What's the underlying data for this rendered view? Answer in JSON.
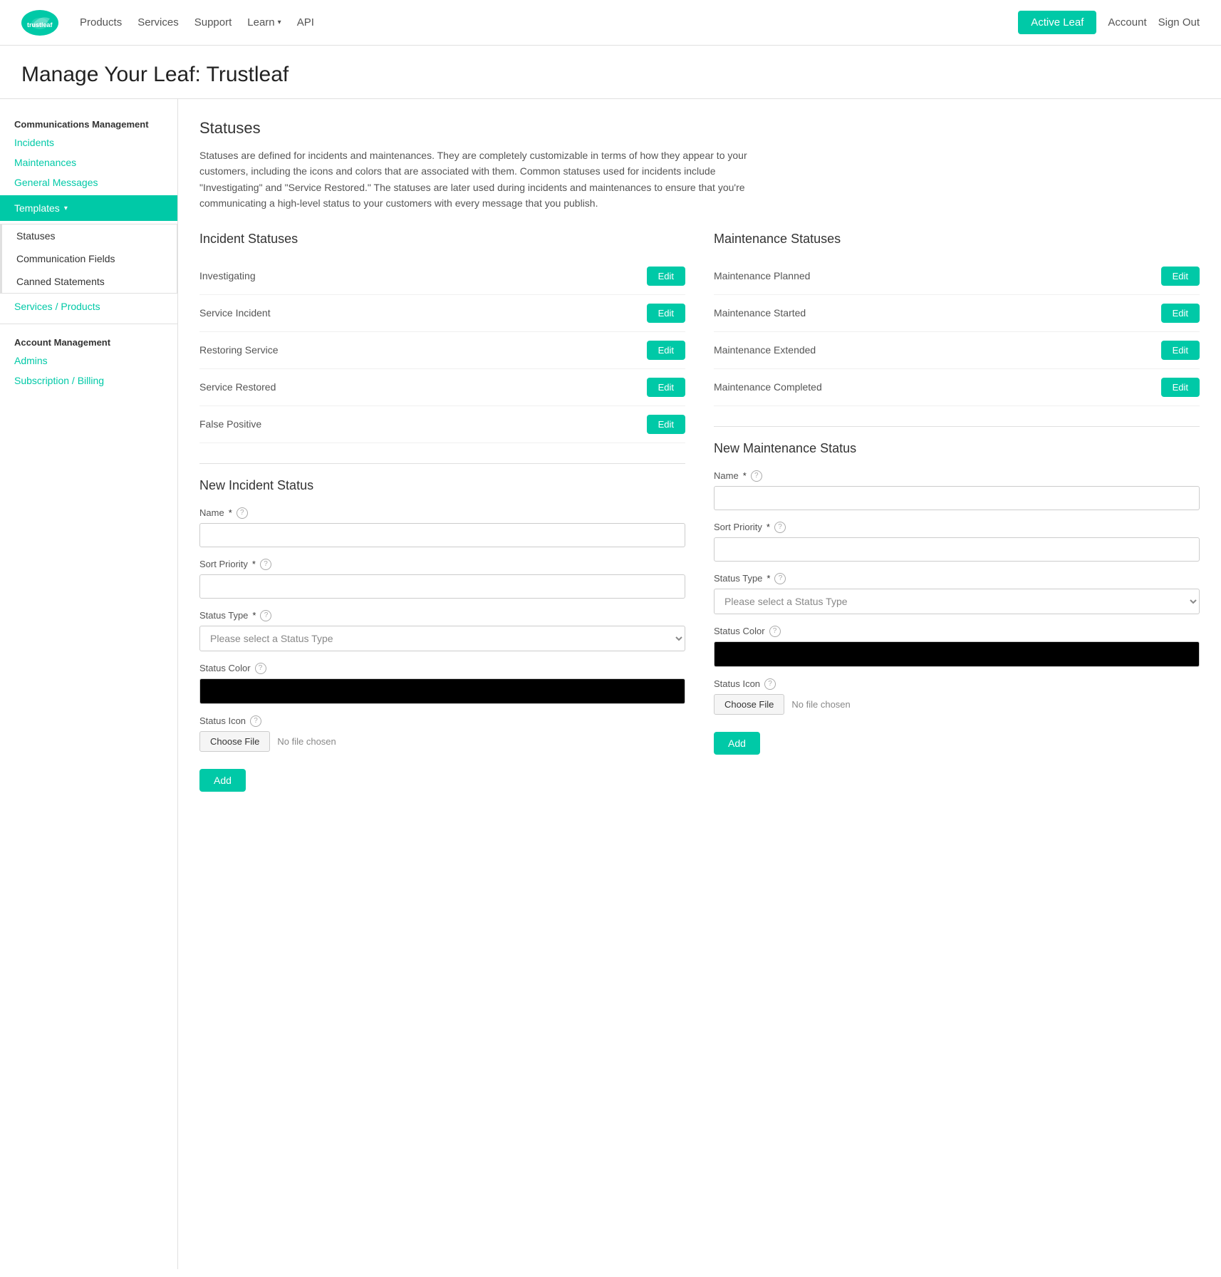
{
  "nav": {
    "logo_alt": "trustleaf",
    "links": [
      "Products",
      "Services",
      "Support",
      "Learn",
      "API"
    ],
    "active_leaf_label": "Active Leaf",
    "account_label": "Account",
    "sign_out_label": "Sign Out"
  },
  "page": {
    "title": "Manage Your Leaf: Trustleaf"
  },
  "sidebar": {
    "comm_management_label": "Communications Management",
    "incidents_label": "Incidents",
    "maintenances_label": "Maintenances",
    "general_messages_label": "General Messages",
    "templates_label": "Templates",
    "statuses_label": "Statuses",
    "comm_fields_label": "Communication Fields",
    "canned_statements_label": "Canned Statements",
    "services_products_label": "Services / Products",
    "account_management_label": "Account Management",
    "admins_label": "Admins",
    "subscription_billing_label": "Subscription / Billing"
  },
  "content": {
    "section_title": "Statuses",
    "section_desc": "Statuses are defined for incidents and maintenances. They are completely customizable in terms of how they appear to your customers, including the icons and colors that are associated with them. Common statuses used for incidents include \"Investigating\" and \"Service Restored.\" The statuses are later used during incidents and maintenances to ensure that you're communicating a high-level status to your customers with every message that you publish.",
    "incident_statuses_title": "Incident Statuses",
    "incident_statuses": [
      {
        "name": "Investigating"
      },
      {
        "name": "Service Incident"
      },
      {
        "name": "Restoring Service"
      },
      {
        "name": "Service Restored"
      },
      {
        "name": "False Positive"
      }
    ],
    "edit_label": "Edit",
    "maintenance_statuses_title": "Maintenance Statuses",
    "maintenance_statuses": [
      {
        "name": "Maintenance Planned"
      },
      {
        "name": "Maintenance Started"
      },
      {
        "name": "Maintenance Extended"
      },
      {
        "name": "Maintenance Completed"
      }
    ],
    "new_incident_status_title": "New Incident Status",
    "new_maintenance_status_title": "New Maintenance Status",
    "name_label": "Name",
    "sort_priority_label": "Sort Priority",
    "status_type_label": "Status Type",
    "status_type_placeholder": "Please select a Status Type",
    "status_color_label": "Status Color",
    "status_icon_label": "Status Icon",
    "choose_file_label": "Choose File",
    "no_file_chosen_label": "No file chosen",
    "add_label": "Add"
  }
}
